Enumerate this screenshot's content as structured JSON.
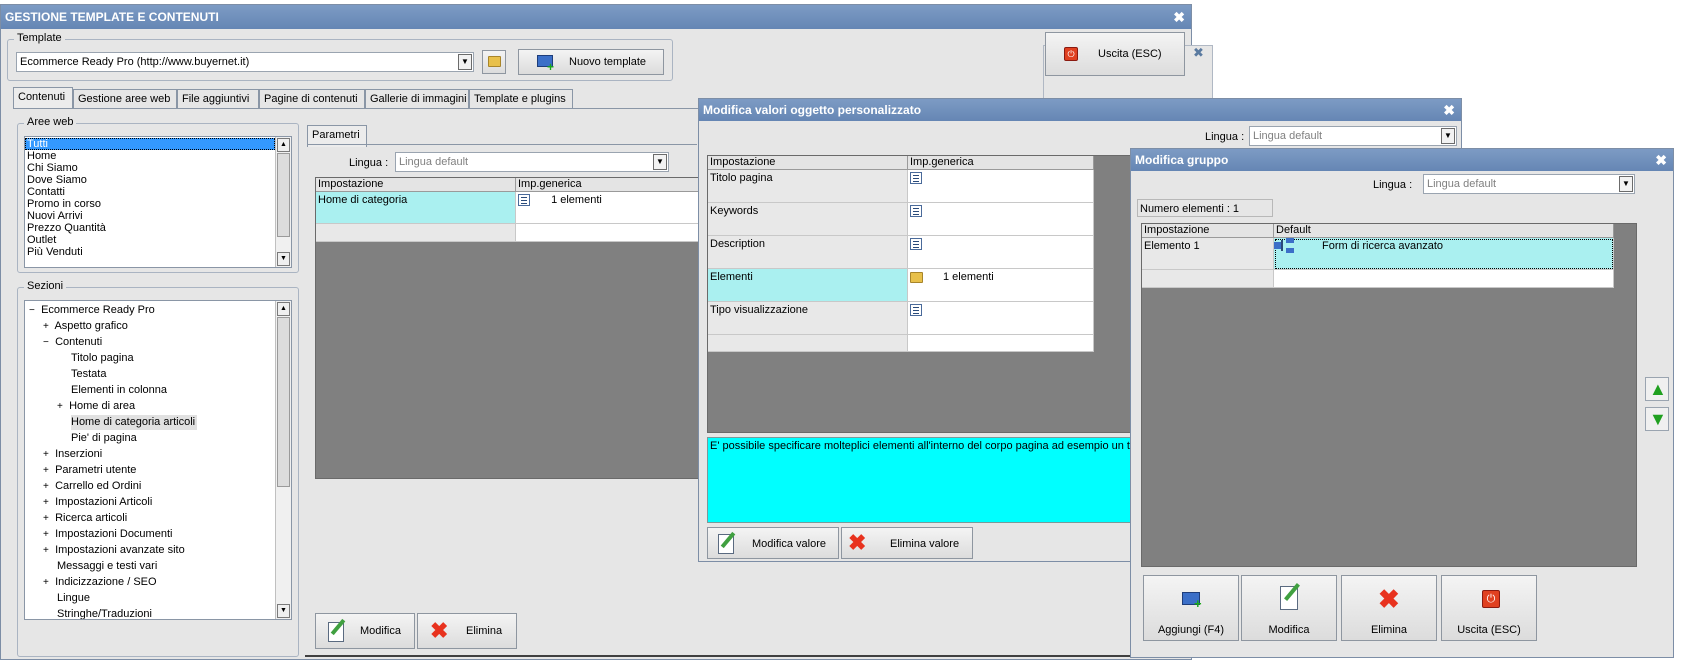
{
  "main_window": {
    "title": "GESTIONE TEMPLATE E CONTENUTI",
    "template_panel_label": "Template",
    "template_value": "Ecommerce Ready Pro (http://www.buyernet.it)",
    "new_template_label": "Nuovo template",
    "exit_label": "Uscita (ESC)",
    "tabs": [
      "Contenuti",
      "Gestione aree web",
      "File aggiuntivi",
      "Pagine di contenuti",
      "Gallerie di immagini",
      "Template e plugins"
    ],
    "aree_web_label": "Aree web",
    "aree_web_items": [
      "Tutti",
      "Home",
      "Chi Siamo",
      "Dove Siamo",
      "Contatti",
      "Promo in corso",
      "Nuovi Arrivi",
      "Prezzo Quantità",
      "Outlet",
      "Più Venduti"
    ],
    "sezioni_label": "Sezioni",
    "tree": [
      {
        "pm": "−",
        "label": "Ecommerce Ready Pro"
      },
      {
        "pm": "+",
        "label": "Aspetto grafico"
      },
      {
        "pm": "−",
        "label": "Contenuti"
      },
      {
        "pm": "",
        "label": "Titolo pagina"
      },
      {
        "pm": "",
        "label": "Testata"
      },
      {
        "pm": "",
        "label": "Elementi in colonna"
      },
      {
        "pm": "+",
        "label": "Home di area"
      },
      {
        "pm": "",
        "label": "Home di categoria articoli"
      },
      {
        "pm": "",
        "label": "Pie' di pagina"
      },
      {
        "pm": "+",
        "label": "Inserzioni"
      },
      {
        "pm": "+",
        "label": "Parametri utente"
      },
      {
        "pm": "+",
        "label": "Carrello ed Ordini"
      },
      {
        "pm": "+",
        "label": "Impostazioni Articoli"
      },
      {
        "pm": "+",
        "label": "Ricerca articoli"
      },
      {
        "pm": "+",
        "label": "Impostazioni Documenti"
      },
      {
        "pm": "+",
        "label": "Impostazioni avanzate sito"
      },
      {
        "pm": "",
        "label": "Messaggi e testi vari"
      },
      {
        "pm": "+",
        "label": "Indicizzazione / SEO"
      },
      {
        "pm": "",
        "label": "Lingue"
      },
      {
        "pm": "",
        "label": "Stringhe/Traduzioni"
      }
    ],
    "params_tab": "Parametri",
    "lingua_label": "Lingua :",
    "lingua_value": "Lingua default",
    "grid_headers": [
      "Impostazione",
      "Imp.generica"
    ],
    "grid_row_name": "Home di categoria",
    "grid_row_value": "1 elementi",
    "modifica_label": "Modifica",
    "elimina_label": "Elimina"
  },
  "custom_window": {
    "title": "Modifica valori oggetto personalizzato",
    "lingua_label": "Lingua :",
    "lingua_value": "Lingua default",
    "grid_headers": [
      "Impostazione",
      "Imp.generica"
    ],
    "rows": [
      {
        "name": "Titolo pagina",
        "value": ""
      },
      {
        "name": "Keywords",
        "value": ""
      },
      {
        "name": "Description",
        "value": ""
      },
      {
        "name": "Elementi",
        "value": "1 elementi"
      },
      {
        "name": "Tipo visualizzazione",
        "value": ""
      }
    ],
    "info_text": "E' possibile specificare molteplici elementi all'interno del corpo pagina ad esempio un testo",
    "modifica_valore_label": "Modifica valore",
    "elimina_valore_label": "Elimina valore"
  },
  "group_window": {
    "title": "Modifica gruppo",
    "lingua_label": "Lingua :",
    "lingua_value": "Lingua default",
    "count_label": "Numero elementi : 1",
    "grid_headers": [
      "Impostazione",
      "Default"
    ],
    "row_name": "Elemento 1",
    "row_value": "Form di ricerca avanzato",
    "add_label": "Aggiungi (F4)",
    "edit_label": "Modifica",
    "delete_label": "Elimina",
    "exit_label": "Uscita (ESC)"
  }
}
